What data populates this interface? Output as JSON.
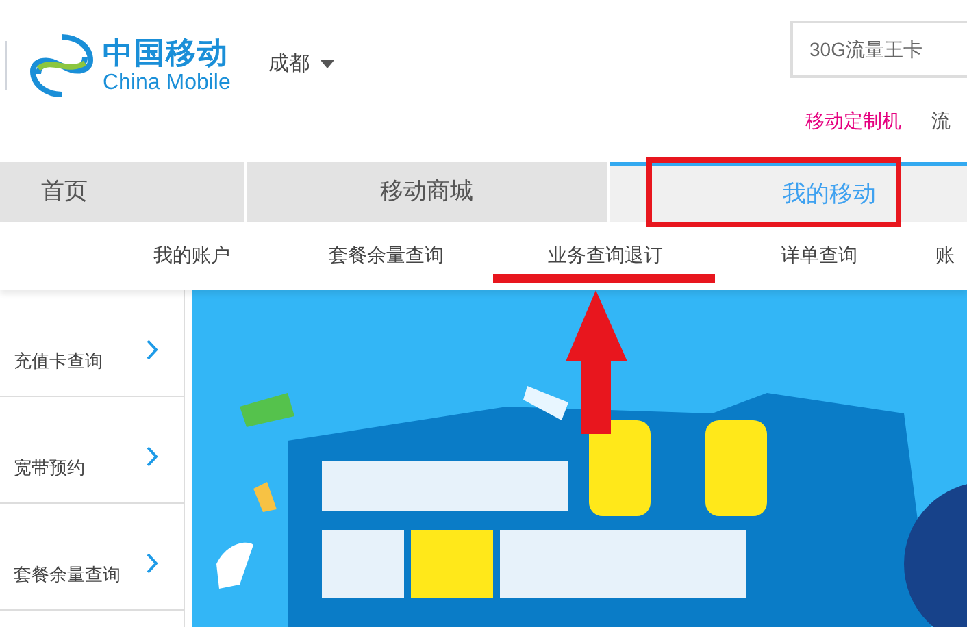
{
  "header": {
    "logo": {
      "name_cn": "中国移动",
      "name_en": "China Mobile"
    },
    "city": "成都",
    "search": {
      "placeholder": "30G流量王卡"
    },
    "links": [
      {
        "label": "移动定制机",
        "kind": "promo"
      },
      {
        "label": "流",
        "kind": "normal"
      }
    ]
  },
  "nav": [
    {
      "label": "首页",
      "selected": false
    },
    {
      "label": "移动商城",
      "selected": false
    },
    {
      "label": "我的移动",
      "selected": true
    }
  ],
  "subnav": [
    {
      "label": "我的账户"
    },
    {
      "label": "套餐余量查询"
    },
    {
      "label": "业务查询退订"
    },
    {
      "label": "详单查询"
    },
    {
      "label": "账"
    }
  ],
  "sidebar": {
    "items": [
      {
        "label": "充值卡查询"
      },
      {
        "label": "宽带预约"
      },
      {
        "label": "套餐余量查询"
      }
    ]
  }
}
